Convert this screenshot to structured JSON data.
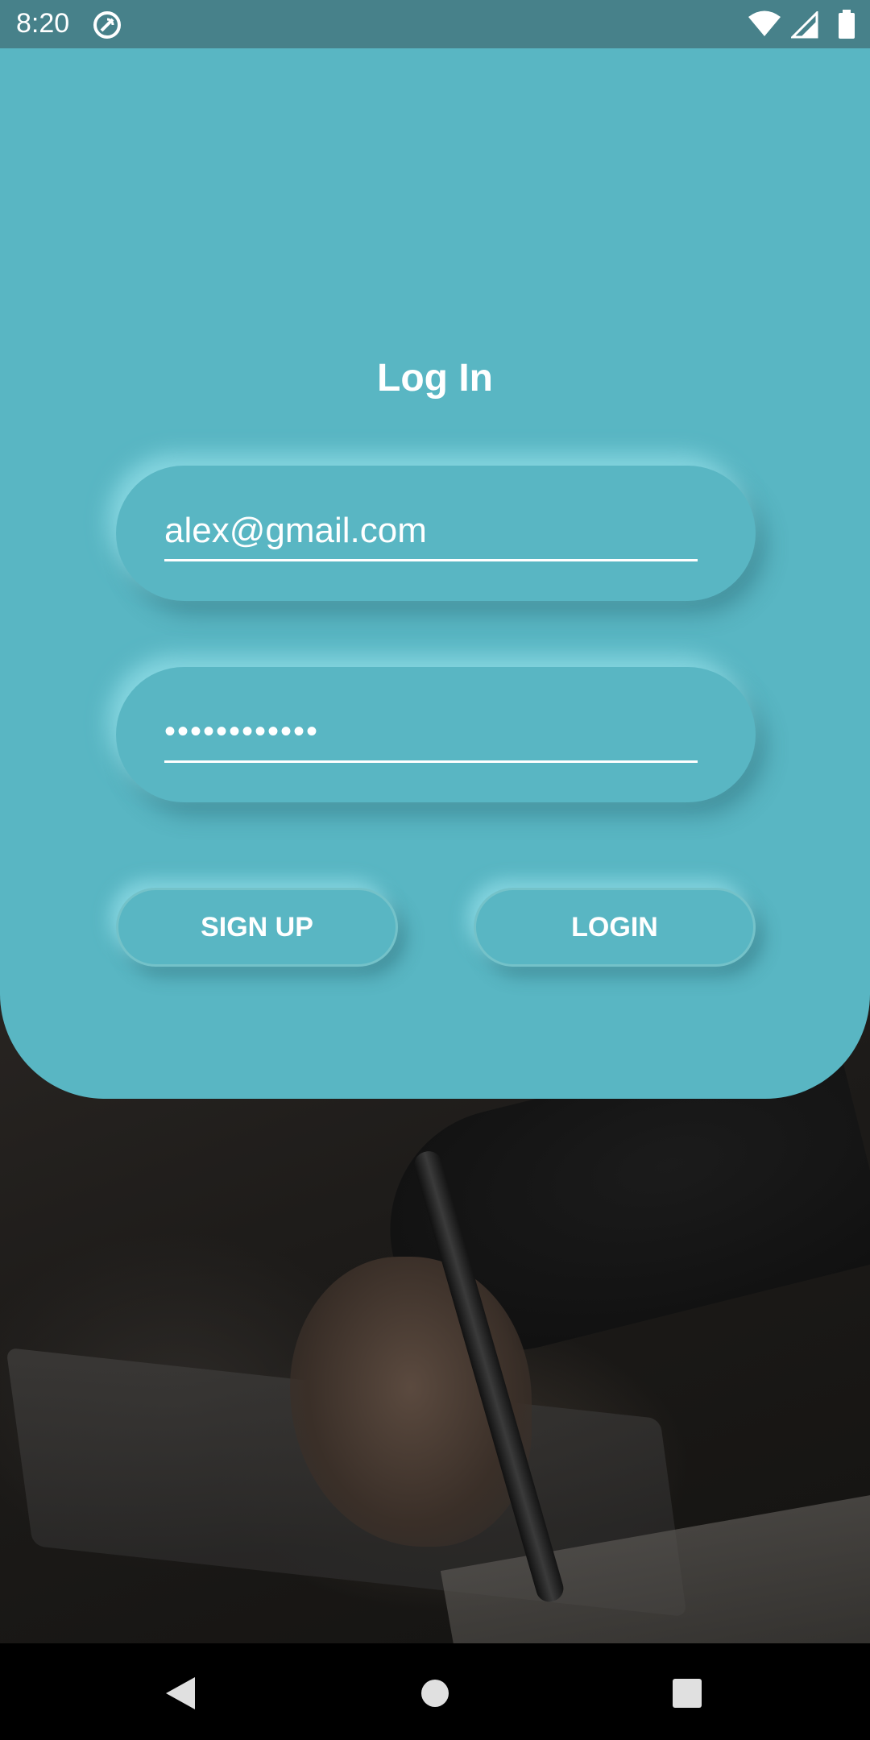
{
  "status_bar": {
    "time": "8:20",
    "app_icon": "sync-circle-icon",
    "wifi_icon": "wifi-icon",
    "signal_icon": "cell-signal-icon",
    "battery_icon": "battery-icon"
  },
  "login": {
    "title": "Log In",
    "email_value": "alex@gmail.com",
    "password_value": "••••••••••••",
    "signup_label": "SIGN UP",
    "login_label": "LOGIN"
  },
  "nav_bar": {
    "back_icon": "back-triangle-icon",
    "home_icon": "home-circle-icon",
    "recents_icon": "recents-square-icon"
  },
  "colors": {
    "card": "#59b6c3",
    "status_bar": "#47818a",
    "text": "#ffffff",
    "nav_bar": "#000000"
  }
}
